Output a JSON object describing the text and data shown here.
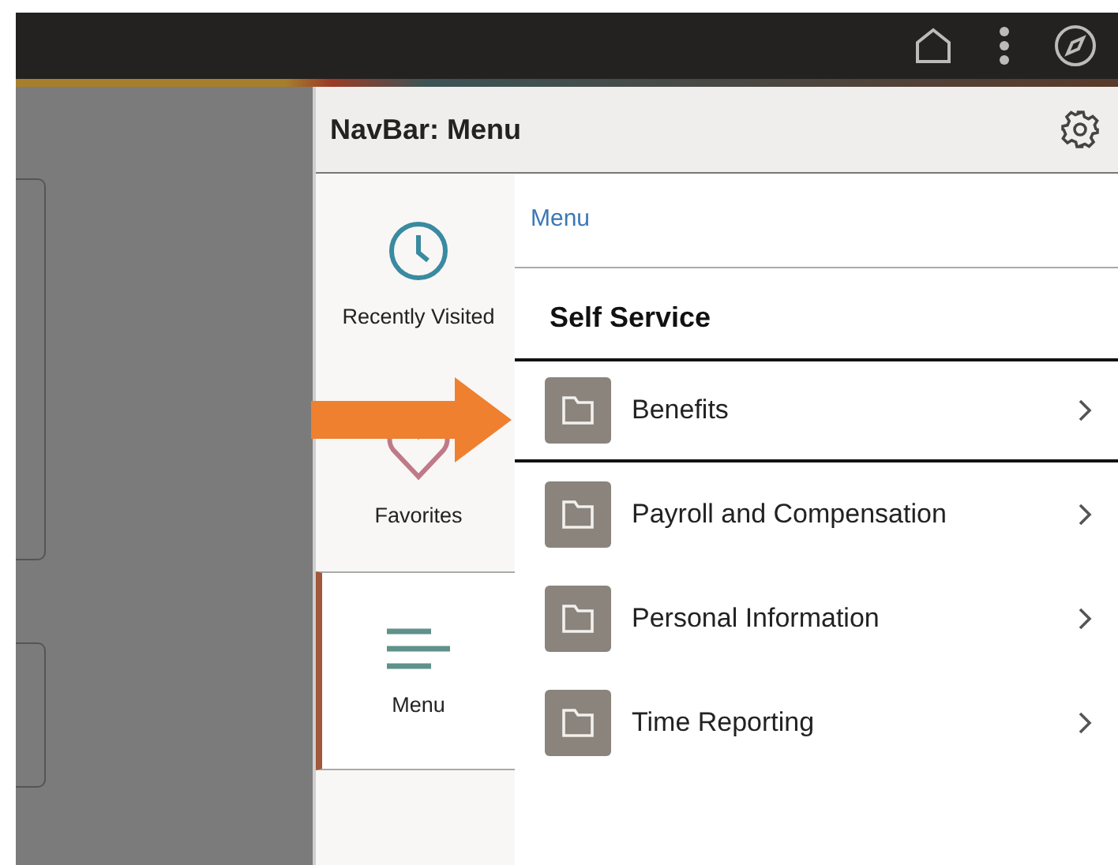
{
  "navbar": {
    "title": "NavBar: Menu"
  },
  "tabs": [
    {
      "label": "Recently Visited",
      "kind": "clock",
      "selected": false
    },
    {
      "label": "Favorites",
      "kind": "heart",
      "selected": false
    },
    {
      "label": "Menu",
      "kind": "lines",
      "selected": true
    }
  ],
  "breadcrumb": "Menu",
  "heading": "Self Service",
  "items": [
    {
      "label": "Benefits",
      "selected": true
    },
    {
      "label": "Payroll and Compensation",
      "selected": false
    },
    {
      "label": "Personal Information",
      "selected": false
    },
    {
      "label": "Time Reporting",
      "selected": false
    }
  ]
}
